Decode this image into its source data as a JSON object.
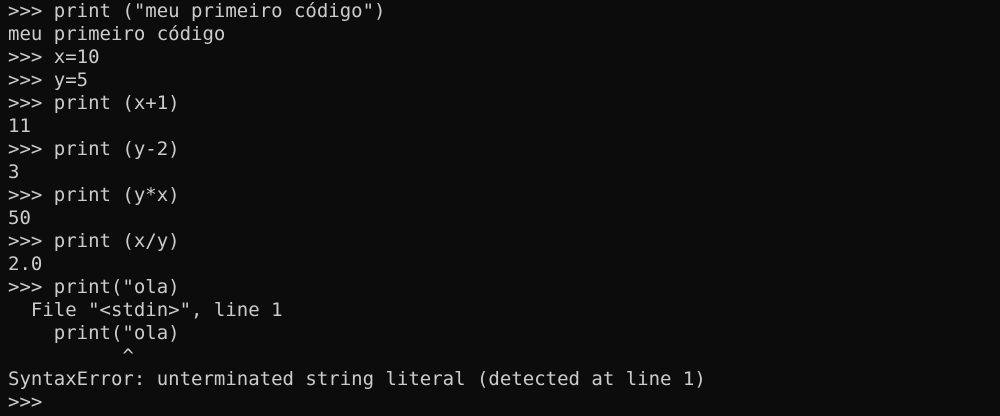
{
  "terminal": {
    "lines": [
      ">>> print (\"meu primeiro código\")",
      "meu primeiro código",
      ">>> x=10",
      ">>> y=5",
      ">>> print (x+1)",
      "11",
      ">>> print (y-2)",
      "3",
      ">>> print (y*x)",
      "50",
      ">>> print (x/y)",
      "2.0",
      ">>> print(\"ola)",
      "  File \"<stdin>\", line 1",
      "    print(\"ola)",
      "          ^",
      "SyntaxError: unterminated string literal (detected at line 1)",
      ">>> "
    ]
  }
}
